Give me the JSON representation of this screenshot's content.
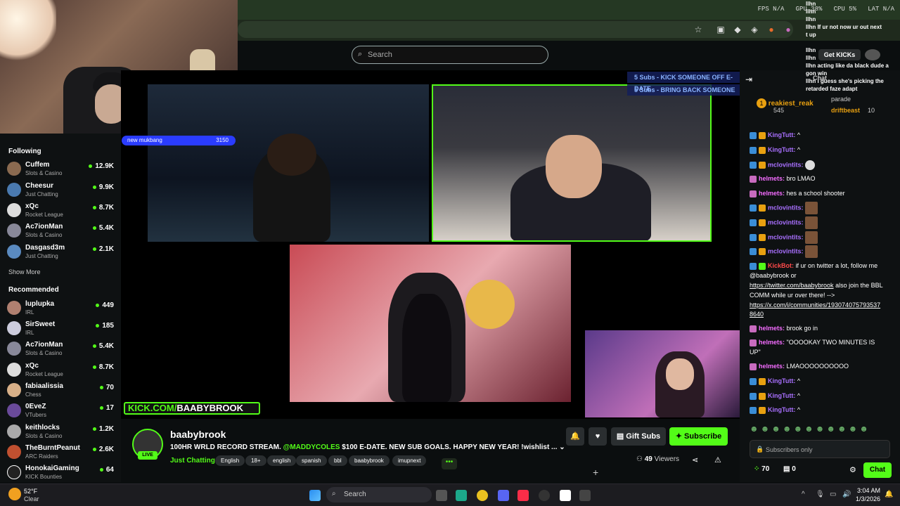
{
  "browser": {
    "perf": "FPS N/A   GPU 38%   CPU 5%   LAT N/A"
  },
  "header": {
    "search_placeholder": "Search"
  },
  "overlay": {
    "mukbang_label": "new mukbang",
    "mukbang_value": "3150",
    "goal1": "5 Subs - KICK SOMEONE OFF E-DATE",
    "goal2": "5 Subs - BRING BACK SOMEONE",
    "kick_logo_prefix": "KICK.COM/",
    "kick_logo_name": "BAABYBROOK"
  },
  "sidebar": {
    "following_title": "Following",
    "following": [
      {
        "name": "Cuffem",
        "category": "Slots & Casino",
        "viewers": "12.9K"
      },
      {
        "name": "Cheesur",
        "category": "Just Chatting",
        "viewers": "9.9K"
      },
      {
        "name": "xQc",
        "category": "Rocket League",
        "viewers": "8.7K"
      },
      {
        "name": "Ac7ionMan",
        "category": "Slots & Casino",
        "viewers": "5.4K"
      },
      {
        "name": "Dasgasd3m",
        "category": "Just Chatting",
        "viewers": "2.1K"
      }
    ],
    "show_more": "Show More",
    "recommended_title": "Recommended",
    "recommended": [
      {
        "name": "luplupka",
        "category": "IRL",
        "viewers": "449"
      },
      {
        "name": "SirSweet",
        "category": "IRL",
        "viewers": "185"
      },
      {
        "name": "Ac7ionMan",
        "category": "Slots & Casino",
        "viewers": "5.4K"
      },
      {
        "name": "xQc",
        "category": "Rocket League",
        "viewers": "8.7K"
      },
      {
        "name": "fabiaalissia",
        "category": "Chess",
        "viewers": "70"
      },
      {
        "name": "0EveZ",
        "category": "VTubers",
        "viewers": "17"
      },
      {
        "name": "keithlocks",
        "category": "Slots & Casino",
        "viewers": "1.2K"
      },
      {
        "name": "TheBurntPeanut",
        "category": "ARC Raiders",
        "viewers": "2.6K"
      },
      {
        "name": "HonokaiGaming",
        "category": "KICK Bounties",
        "viewers": "64"
      }
    ]
  },
  "stream": {
    "channel": "baabybrook",
    "live": "LIVE",
    "title_pre": "100HR WRLD RECORD STREAM.",
    "title_mention": "@MADDYCOLES",
    "title_post": "$100 E-DATE. NEW SUB GOALS. HAPPY NEW YEAR! !wishlist ...",
    "category": "Just Chatting",
    "tags": [
      "English",
      "18+",
      "english",
      "spanish",
      "bbl",
      "baabybrook",
      "imupnext"
    ],
    "gift_subs": "Gift Subs",
    "subscribe": "Subscribe",
    "viewers_count": "49",
    "viewers_label": "Viewers"
  },
  "chat": {
    "top_user": "reakiest_reak",
    "top_count": "545",
    "top_rank": "1",
    "second_user": "driftbeast",
    "second_count": "10",
    "messages": [
      {
        "user": "KingTutt:",
        "text": "^",
        "color": "#a970ff"
      },
      {
        "user": "KingTutt:",
        "text": "^",
        "color": "#a970ff"
      },
      {
        "user": "mclovintits:",
        "text": "",
        "color": "#a970ff"
      },
      {
        "user": "helmets:",
        "text": "bro LMAO",
        "color": "#f46cff"
      },
      {
        "user": "helmets:",
        "text": "hes a school shooter",
        "color": "#f46cff"
      },
      {
        "user": "mclovintits:",
        "text": "",
        "color": "#a970ff"
      },
      {
        "user": "mclovintits:",
        "text": "",
        "color": "#a970ff"
      },
      {
        "user": "mclovintits:",
        "text": "",
        "color": "#a970ff"
      },
      {
        "user": "mclovintits:",
        "text": "",
        "color": "#a970ff"
      }
    ],
    "bot_user": "KickBot:",
    "bot_line1": "if ur on twitter a lot, follow me",
    "bot_line2": "@baabybrook or",
    "bot_link1": "https://twitter.com/baabybrook",
    "bot_line3": "also join the BBL",
    "bot_line4": "COMM while ur over there! -->",
    "bot_link2": "https://x.com/i/communities/193074075793537",
    "bot_link2b": "8640",
    "messages2": [
      {
        "user": "helmets:",
        "text": "brook go in",
        "color": "#f46cff"
      },
      {
        "user": "helmets:",
        "text": "\"OOOOKAY TWO MINUTES IS",
        "color": "#f46cff"
      },
      {
        "user": "",
        "text": "UP\"",
        "color": "#f46cff"
      },
      {
        "user": "helmets:",
        "text": "LMAOOOOOOOOOO",
        "color": "#f46cff"
      },
      {
        "user": "KingTutt:",
        "text": "^",
        "color": "#a970ff"
      },
      {
        "user": "KingTutt:",
        "text": "^",
        "color": "#a970ff"
      },
      {
        "user": "KingTutt:",
        "text": "^",
        "color": "#a970ff"
      }
    ],
    "subs_only": "Subscribers only",
    "points": "70",
    "gifts": "0",
    "send": "Chat"
  },
  "overlay_chat": {
    "lines": [
      "llhn",
      "llhn",
      "llhn",
      "llhn If ur not now ur out next",
      "t up",
      "llhn",
      "llhn",
      "llhn acting like da black dude a",
      "gon win",
      "llhn I guess she's picking the",
      "retarded faze adapt"
    ],
    "get_kicks": "Get KICKs",
    "chat_label": "Chat",
    "parade": "parade"
  },
  "taskbar": {
    "weather_temp": "52°F",
    "weather_desc": "Clear",
    "search": "Search",
    "time": "3:04 AM",
    "date": "1/3/2026"
  },
  "colors": {
    "accent": "#53fc18",
    "bg": "#0b0e0f"
  }
}
